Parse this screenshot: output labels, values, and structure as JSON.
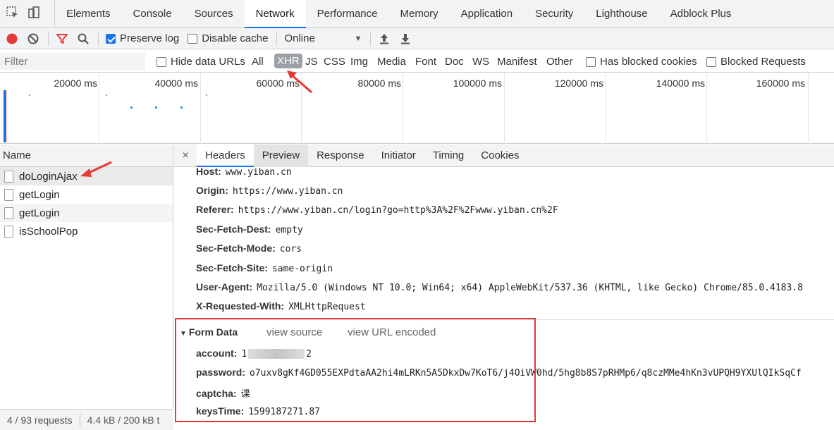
{
  "tabs": [
    "Elements",
    "Console",
    "Sources",
    "Network",
    "Performance",
    "Memory",
    "Application",
    "Security",
    "Lighthouse",
    "Adblock Plus"
  ],
  "active_tab": "Network",
  "toolbar": {
    "preserve_log": "Preserve log",
    "disable_cache": "Disable cache",
    "throttle": "Online"
  },
  "filterbar": {
    "placeholder": "Filter",
    "hide_data_urls": "Hide data URLs",
    "types": [
      "All",
      "XHR",
      "JS",
      "CSS",
      "Img",
      "Media",
      "Font",
      "Doc",
      "WS",
      "Manifest",
      "Other"
    ],
    "selected_type": "XHR",
    "has_blocked_cookies": "Has blocked cookies",
    "blocked_requests": "Blocked Requests"
  },
  "timeline": {
    "ticks": [
      "20000 ms",
      "40000 ms",
      "60000 ms",
      "80000 ms",
      "100000 ms",
      "120000 ms",
      "140000 ms",
      "160000 ms"
    ]
  },
  "requests": {
    "header": "Name",
    "items": [
      "doLoginAjax",
      "getLogin",
      "getLogin",
      "isSchoolPop"
    ],
    "status_requests": "4 / 93 requests",
    "status_size": "4.4 kB / 200 kB t"
  },
  "detail": {
    "close": "×",
    "tabs": [
      "Headers",
      "Preview",
      "Response",
      "Initiator",
      "Timing",
      "Cookies"
    ],
    "active_tab": "Headers",
    "headers": [
      {
        "key": "Host:",
        "value": "www.yiban.cn"
      },
      {
        "key": "Origin:",
        "value": "https://www.yiban.cn"
      },
      {
        "key": "Referer:",
        "value": "https://www.yiban.cn/login?go=http%3A%2F%2Fwww.yiban.cn%2F"
      },
      {
        "key": "Sec-Fetch-Dest:",
        "value": "empty"
      },
      {
        "key": "Sec-Fetch-Mode:",
        "value": "cors"
      },
      {
        "key": "Sec-Fetch-Site:",
        "value": "same-origin"
      },
      {
        "key": "User-Agent:",
        "value": "Mozilla/5.0 (Windows NT 10.0; Win64; x64) AppleWebKit/537.36 (KHTML, like Gecko) Chrome/85.0.4183.8"
      },
      {
        "key": "X-Requested-With:",
        "value": "XMLHttpRequest"
      }
    ],
    "form_data": {
      "title": "Form Data",
      "view_source": "view source",
      "view_url_encoded": "view URL encoded",
      "fields": [
        {
          "key": "account:",
          "value_start": "1",
          "value_end": "2"
        },
        {
          "key": "password:",
          "value": "o7uxv8gKf4GD055EXPdtaAA2hi4mLRKn5A5DkxDw7KoT6/j4OiVW0hd/5hg8b8S7pRHMp6/q8czMMe4hKn3vUPQH9YXUlQIkSqCf"
        },
        {
          "key": "captcha:",
          "value": "课"
        },
        {
          "key": "keysTime:",
          "value": "1599187271.87"
        }
      ]
    }
  },
  "colors": {
    "accent": "#1a73e8",
    "record": "#e53935",
    "annotation": "#e53935"
  }
}
